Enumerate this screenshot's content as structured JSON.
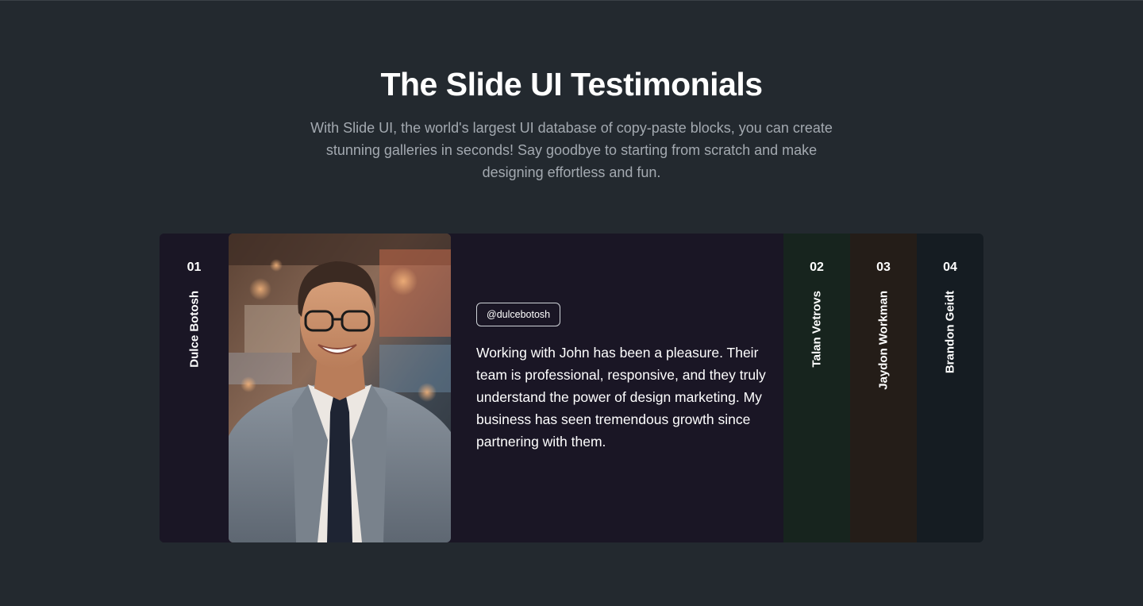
{
  "header": {
    "title": "The Slide UI Testimonials",
    "subtitle": "With Slide UI, the world's largest UI database of copy-paste blocks, you can create stunning galleries in seconds! Say goodbye to starting from scratch and make designing effortless and fun."
  },
  "slides": [
    {
      "number": "01",
      "name": "Dulce Botosh",
      "handle": "@dulcebotosh",
      "quote": "Working with John has been a pleasure. Their team is professional, responsive, and they truly understand the power of design marketing. My business has seen tremendous growth since partnering with them.",
      "color": "#1a1625"
    },
    {
      "number": "02",
      "name": "Talan Vetrovs",
      "color": "#17241e"
    },
    {
      "number": "03",
      "name": "Jaydon Workman",
      "color": "#241d18"
    },
    {
      "number": "04",
      "name": "Brandon Geidt",
      "color": "#151c22"
    }
  ],
  "colors": {
    "background": "#23292f",
    "title": "#ffffff",
    "subtitle": "#a3a9b0"
  }
}
